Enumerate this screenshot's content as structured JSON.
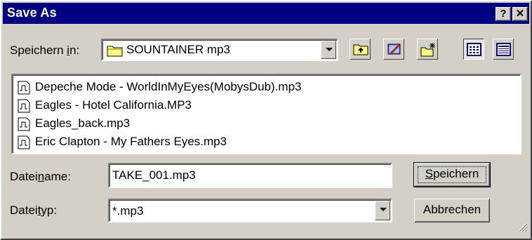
{
  "window": {
    "title": "Save As"
  },
  "titlebar": {
    "help_glyph": "?",
    "close_glyph": "✕"
  },
  "location": {
    "label_pre": "Speichern ",
    "label_accel": "i",
    "label_post": "n:",
    "folder_icon": "folder-icon",
    "value": "SOUNTAINER mp3"
  },
  "toolbar": {
    "icons": [
      "up-one-level-icon",
      "desktop-icon",
      "new-folder-icon",
      "list-view-icon",
      "details-view-icon"
    ]
  },
  "files": [
    {
      "name": "Depeche Mode - WorldInMyEyes(MobysDub).mp3",
      "icon": "audio-file-icon"
    },
    {
      "name": "Eagles - Hotel California.MP3",
      "icon": "audio-file-icon"
    },
    {
      "name": "Eagles_back.mp3",
      "icon": "audio-file-icon"
    },
    {
      "name": "Eric Clapton - My Fathers Eyes.mp3",
      "icon": "audio-file-icon"
    }
  ],
  "filename": {
    "label_pre": "Datei",
    "label_accel": "n",
    "label_post": "ame:",
    "value": "TAKE_001.mp3"
  },
  "filetype": {
    "label_pre": "Datei",
    "label_accel": "t",
    "label_post": "yp:",
    "value": "*.mp3"
  },
  "buttons": {
    "save_accel": "S",
    "save_rest": "peichern",
    "cancel": "Abbrechen"
  },
  "colors": {
    "titlebar": "#000080",
    "face": "#d4d0c8",
    "window": "#ffffff"
  }
}
